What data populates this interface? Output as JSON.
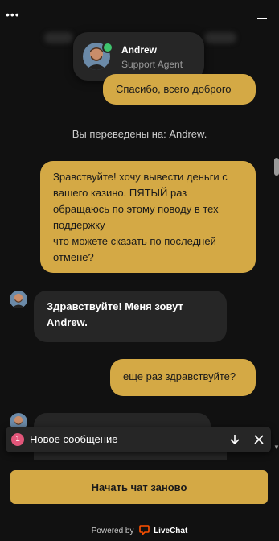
{
  "header": {
    "menu_icon": "more-dots-icon",
    "minimize_icon": "minimize-icon"
  },
  "agent": {
    "name": "Andrew",
    "role": "Support Agent",
    "status_color": "#3ec46d"
  },
  "messages": [
    {
      "type": "outgoing",
      "text": "Спасибо, всего доброго"
    },
    {
      "type": "system",
      "text": "Вы переведены на: Andrew."
    },
    {
      "type": "outgoing",
      "text": "Зравствуйте! хочу вывести деньги с вашего казино. ПЯТЫЙ раз обращаюсь по этому поводу в тех поддержку\nчто можете сказать по последней отмене?"
    },
    {
      "type": "incoming",
      "text": "Здравствуйте! Меня зовут Andrew."
    },
    {
      "type": "outgoing",
      "text": "еще раз здравствуйте?"
    }
  ],
  "new_message_bar": {
    "count": "1",
    "text": "Новое сообщение"
  },
  "restart_button": {
    "label": "Начать чат заново"
  },
  "footer": {
    "powered_by": "Powered by",
    "brand": "LiveChat"
  },
  "colors": {
    "accent": "#d4a945",
    "background": "#111111",
    "bubble_incoming": "#262626",
    "badge": "#e2567a"
  }
}
